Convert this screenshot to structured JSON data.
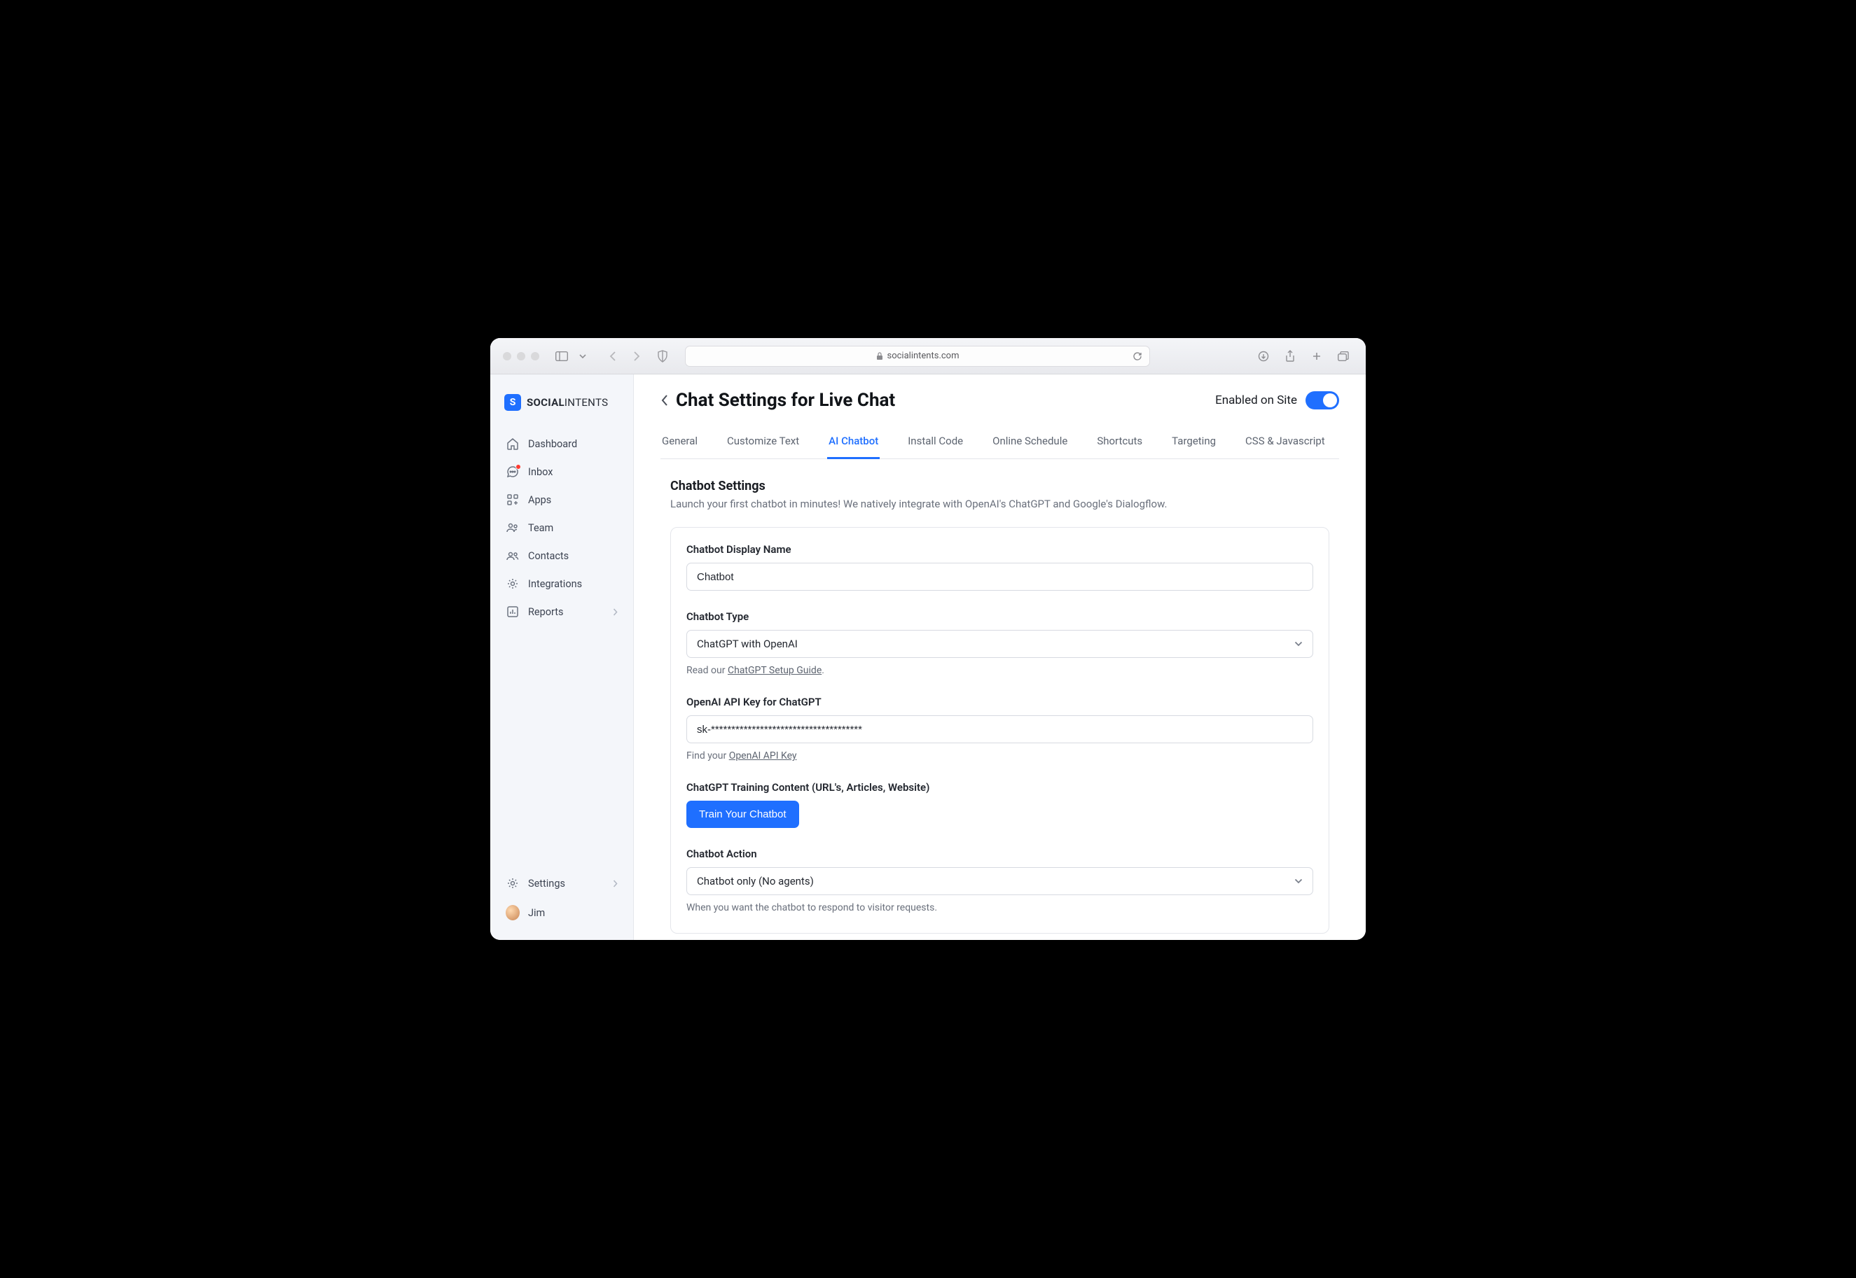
{
  "browser": {
    "url_host": "socialintents.com"
  },
  "brand": {
    "name_bold": "SOCIAL",
    "name_light": "INTENTS"
  },
  "sidebar": {
    "items": [
      {
        "label": "Dashboard"
      },
      {
        "label": "Inbox"
      },
      {
        "label": "Apps"
      },
      {
        "label": "Team"
      },
      {
        "label": "Contacts"
      },
      {
        "label": "Integrations"
      },
      {
        "label": "Reports"
      }
    ],
    "bottom": {
      "settings": "Settings",
      "user": "Jim"
    }
  },
  "header": {
    "title": "Chat Settings for Live Chat",
    "enabled_label": "Enabled on Site"
  },
  "tabs": [
    {
      "label": "General"
    },
    {
      "label": "Customize Text"
    },
    {
      "label": "AI Chatbot"
    },
    {
      "label": "Install Code"
    },
    {
      "label": "Online Schedule"
    },
    {
      "label": "Shortcuts"
    },
    {
      "label": "Targeting"
    },
    {
      "label": "CSS & Javascript"
    }
  ],
  "section": {
    "title": "Chatbot Settings",
    "desc": "Launch your first chatbot in minutes! We natively integrate with OpenAI's ChatGPT and Google's Dialogflow."
  },
  "fields": {
    "display_name": {
      "label": "Chatbot Display Name",
      "value": "Chatbot"
    },
    "type": {
      "label": "Chatbot Type",
      "value": "ChatGPT with OpenAI",
      "help_prefix": "Read our ",
      "help_link": "ChatGPT Setup Guide",
      "help_suffix": "."
    },
    "api_key": {
      "label": "OpenAI API Key for ChatGPT",
      "value": "sk-*************************************",
      "help_prefix": "Find your ",
      "help_link": "OpenAI API Key"
    },
    "training": {
      "label": "ChatGPT Training Content (URL's, Articles, Website)",
      "button": "Train Your Chatbot"
    },
    "action": {
      "label": "Chatbot Action",
      "value": "Chatbot only (No agents)",
      "help": "When you want the chatbot to respond to visitor requests."
    }
  }
}
